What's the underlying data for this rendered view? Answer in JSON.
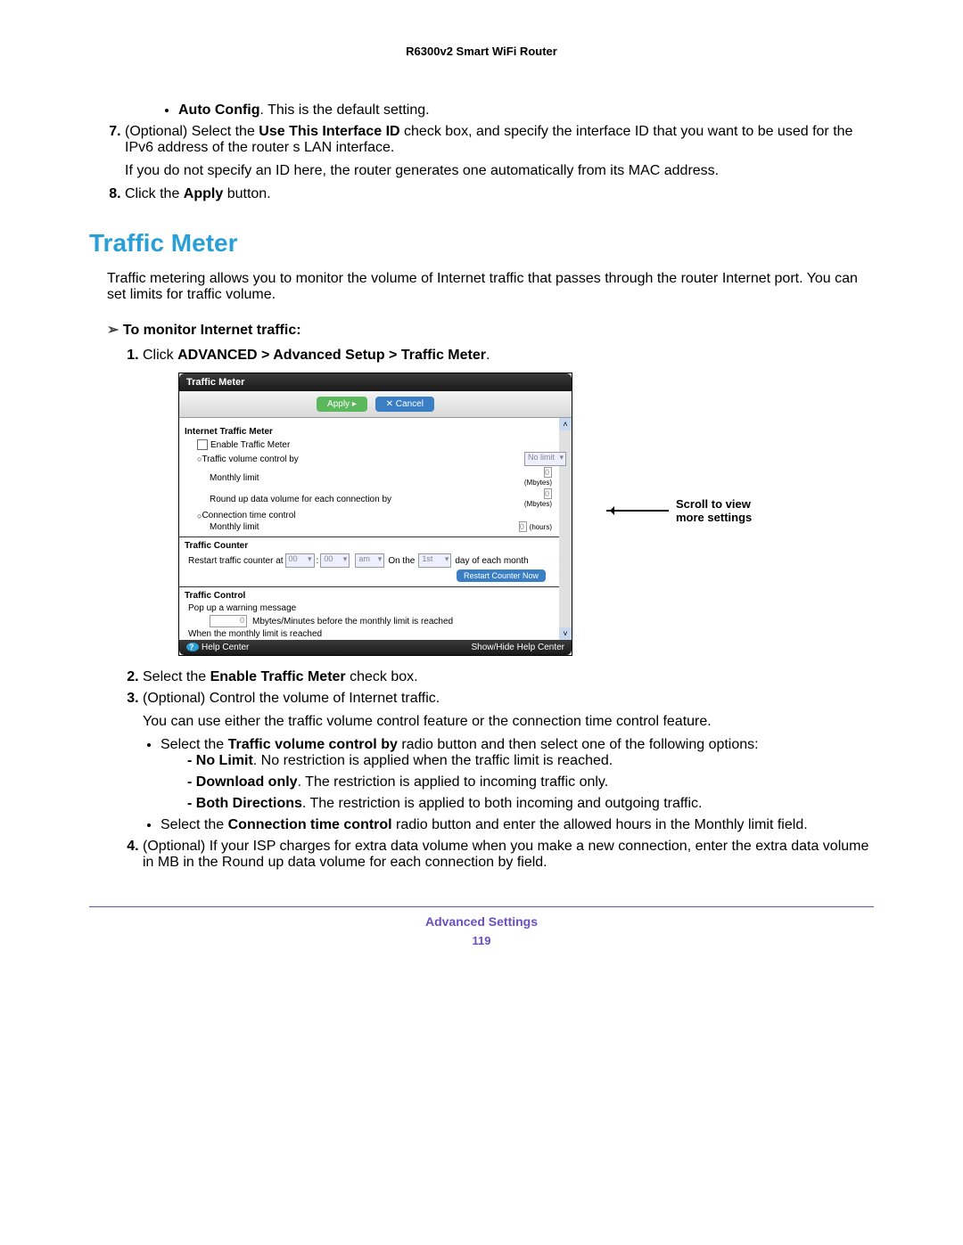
{
  "header": {
    "title": "R6300v2 Smart WiFi Router"
  },
  "top": {
    "bullet": {
      "b": "Auto Config",
      "rest": ". This is the default setting."
    },
    "item7": {
      "pre": "(Optional) Select the ",
      "b": "Use This Interface ID",
      "post": " check box, and specify the interface ID that you want to be used for the IPv6 address of the router s LAN interface."
    },
    "item7_note": "If you do not specify an ID here, the router generates one automatically from its MAC address.",
    "item8": {
      "pre": "Click the ",
      "b": "Apply",
      "post": " button."
    }
  },
  "section": {
    "title": "Traffic Meter",
    "intro": "Traffic metering allows you to monitor the volume of Internet traffic that passes through the router Internet port. You can set limits for traffic volume.",
    "proc_head": "To monitor Internet traffic:",
    "step1": {
      "pre": "Click ",
      "b": "ADVANCED > Advanced Setup > Traffic Meter",
      "post": "."
    },
    "step2": {
      "pre": "Select the ",
      "b": "Enable Traffic Meter",
      "post": " check box."
    },
    "step3": "(Optional) Control the volume of Internet traffic.",
    "step3_note": "You can use either the traffic volume control feature or the connection time control feature.",
    "sub1": {
      "pre": "Select the ",
      "b": "Traffic volume control by",
      "post": " radio button and then select one of the following options:"
    },
    "d1": {
      "b": "No Limit",
      "rest": ". No restriction is applied when the traffic limit is reached."
    },
    "d2": {
      "b": "Download only",
      "rest": ". The restriction is applied to incoming traffic only."
    },
    "d3": {
      "b": "Both Directions",
      "rest": ". The restriction is applied to both incoming and outgoing traffic."
    },
    "sub2": {
      "pre": "Select the ",
      "b": "Connection time control",
      "post": " radio button and enter the allowed hours in the Monthly limit field."
    },
    "step4": "(Optional) If your ISP charges for extra data volume when you make a new connection, enter the extra data volume in MB in the Round up data volume for each connection by field."
  },
  "shot": {
    "title": "Traffic Meter",
    "apply": "Apply ▸",
    "cancel": "✕ Cancel",
    "sec1": "Internet Traffic Meter",
    "enable": "Enable Traffic Meter",
    "tvcb": "Traffic volume control by",
    "nolimit": "No limit",
    "mlimit": "Monthly limit",
    "mbytes": "(Mbytes)",
    "round": "Round up data volume for each connection by",
    "ctc": "Connection time control",
    "hours": "(hours)",
    "sec2": "Traffic Counter",
    "restart_at": "Restart traffic counter at",
    "h": "00",
    "m": "00",
    "ampm": "am",
    "on": "On the",
    "day": "1st",
    "dom": "day of each month",
    "restart_btn": "Restart Counter Now",
    "sec3": "Traffic Control",
    "popup": "Pop up a warning message",
    "before": "Mbytes/Minutes before the monthly limit is reached",
    "when": "When the monthly limit is reached",
    "zero": "0",
    "help": "Help Center",
    "showhide": "Show/Hide Help Center"
  },
  "annot": {
    "line1": "Scroll to view",
    "line2": "more settings"
  },
  "footer": {
    "title": "Advanced Settings",
    "page": "119"
  }
}
